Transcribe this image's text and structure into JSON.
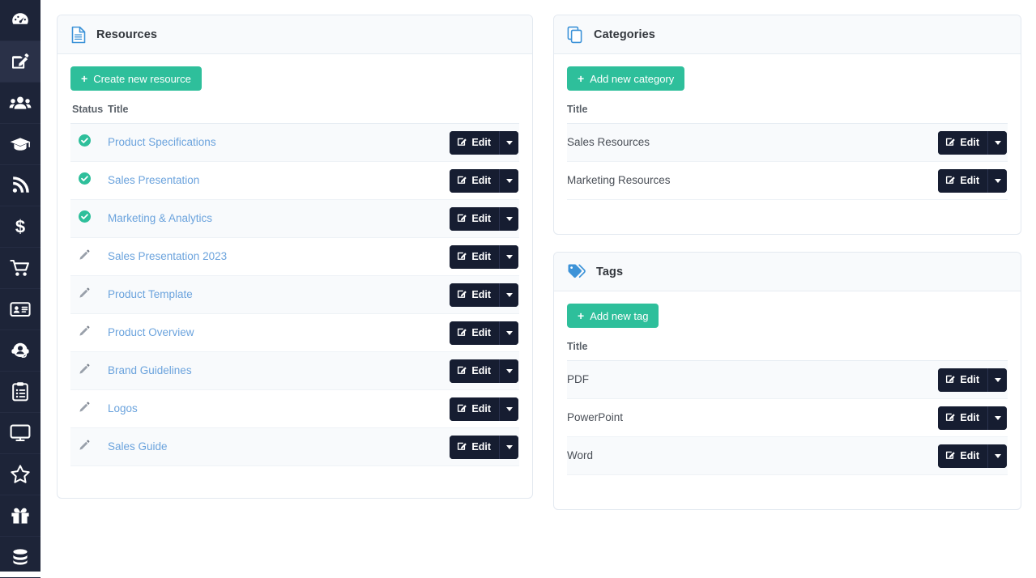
{
  "sidebar": {
    "items": [
      {
        "name": "dashboard",
        "icon": "gauge-icon",
        "active": false
      },
      {
        "name": "content-editor",
        "icon": "pencil-square-icon",
        "active": true
      },
      {
        "name": "users",
        "icon": "users-icon",
        "active": false
      },
      {
        "name": "training",
        "icon": "graduation-cap-icon",
        "active": false
      },
      {
        "name": "feed",
        "icon": "rss-icon",
        "active": false
      },
      {
        "name": "finance",
        "icon": "dollar-icon",
        "active": false
      },
      {
        "name": "shop",
        "icon": "shopping-cart-icon",
        "active": false
      },
      {
        "name": "contacts",
        "icon": "id-card-icon",
        "active": false
      },
      {
        "name": "support",
        "icon": "headset-icon",
        "active": false
      },
      {
        "name": "tasks",
        "icon": "clipboard-list-icon",
        "active": false
      },
      {
        "name": "displays",
        "icon": "desktop-icon",
        "active": false
      },
      {
        "name": "favorites",
        "icon": "star-icon",
        "active": false
      },
      {
        "name": "rewards",
        "icon": "gift-icon",
        "active": false
      },
      {
        "name": "database",
        "icon": "database-icon",
        "active": false
      }
    ]
  },
  "resources": {
    "title": "Resources",
    "header_icon": "file-document-icon",
    "create_button": "Create new resource",
    "columns": {
      "status": "Status",
      "title": "Title"
    },
    "rows": [
      {
        "status": "published",
        "title": "Product Specifications",
        "edit_label": "Edit"
      },
      {
        "status": "published",
        "title": "Sales Presentation",
        "edit_label": "Edit"
      },
      {
        "status": "published",
        "title": "Marketing & Analytics",
        "edit_label": "Edit"
      },
      {
        "status": "draft",
        "title": "Sales Presentation 2023",
        "edit_label": "Edit"
      },
      {
        "status": "draft",
        "title": "Product Template",
        "edit_label": "Edit"
      },
      {
        "status": "draft",
        "title": "Product Overview",
        "edit_label": "Edit"
      },
      {
        "status": "draft",
        "title": "Brand Guidelines",
        "edit_label": "Edit"
      },
      {
        "status": "draft",
        "title": "Logos",
        "edit_label": "Edit"
      },
      {
        "status": "draft",
        "title": "Sales Guide",
        "edit_label": "Edit"
      }
    ]
  },
  "categories": {
    "title": "Categories",
    "header_icon": "copy-layers-icon",
    "create_button": "Add new category",
    "columns": {
      "title": "Title"
    },
    "rows": [
      {
        "title": "Sales Resources",
        "edit_label": "Edit"
      },
      {
        "title": "Marketing Resources",
        "edit_label": "Edit"
      }
    ]
  },
  "tags": {
    "title": "Tags",
    "header_icon": "tag-icon",
    "create_button": "Add new tag",
    "columns": {
      "title": "Title"
    },
    "rows": [
      {
        "title": "PDF",
        "edit_label": "Edit"
      },
      {
        "title": "PowerPoint",
        "edit_label": "Edit"
      },
      {
        "title": "Word",
        "edit_label": "Edit"
      }
    ]
  },
  "colors": {
    "sidebar_bg": "#1d2438",
    "sidebar_active_bg": "#2a3148",
    "accent_green": "#2ebf9b",
    "dark_button": "#161d31",
    "link_blue": "#6ba3dd",
    "header_icon_blue": "#3d93d8",
    "status_published": "#2ebf9b",
    "status_draft": "#8d949e",
    "card_border": "#e3e9f0",
    "row_stripe": "#f8fafc"
  },
  "icons": {
    "plus": "+",
    "edit_pencil_square": "pencil-square-icon",
    "caret_down": "chevron-down-icon",
    "check_circle": "check-circle-icon",
    "pencil": "pencil-icon"
  }
}
